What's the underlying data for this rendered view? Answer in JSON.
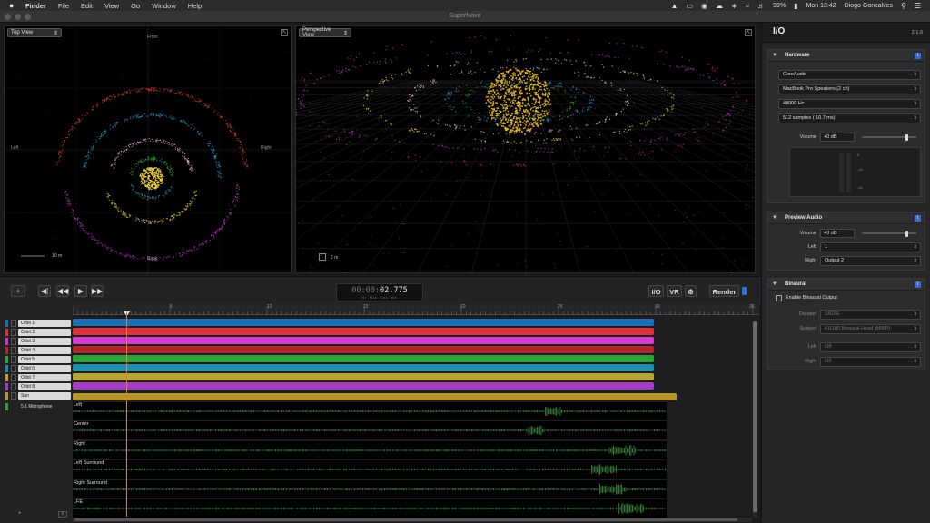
{
  "menubar": {
    "apple_icon": "apple-icon",
    "items": [
      {
        "label": "Finder",
        "bold": true
      },
      {
        "label": "File"
      },
      {
        "label": "Edit"
      },
      {
        "label": "View"
      },
      {
        "label": "Go"
      },
      {
        "label": "Window"
      },
      {
        "label": "Help"
      }
    ],
    "battery": "99%",
    "clock": "Mon 13:42",
    "user": "Diogo Goncalves"
  },
  "window": {
    "title": "SuperNova"
  },
  "top_view": {
    "mode": "Top View",
    "front": "Front",
    "back": "Back",
    "left": "Left",
    "right": "Right",
    "scale": "10 m"
  },
  "perspective_view": {
    "mode": "Perspective View",
    "scale": "2 m"
  },
  "transport": {
    "add": "+",
    "timecode_prefix": "00:00:",
    "timecode_value": "02.775",
    "timecode_units": "Hr  Min  Sec  Ms",
    "io": "I/O",
    "vr": "VR",
    "render": "Render"
  },
  "ruler": {
    "ticks": [
      "5",
      "10",
      "15",
      "20",
      "25",
      "30",
      "35"
    ]
  },
  "tracks": [
    {
      "name": "Orbit 1",
      "color": "#1f6fb4"
    },
    {
      "name": "Orbit 2",
      "color": "#e0323c"
    },
    {
      "name": "Orbit 3",
      "color": "#d43bd0"
    },
    {
      "name": "Orbit 4",
      "color": "#b3242b"
    },
    {
      "name": "Orbit 5",
      "color": "#2ea33a"
    },
    {
      "name": "Orbit 6",
      "color": "#1e8fa8"
    },
    {
      "name": "Orbit 7",
      "color": "#b8a536"
    },
    {
      "name": "Orbit 8",
      "color": "#a43dc4"
    },
    {
      "name": "Sun",
      "color": "#b8952a"
    },
    {
      "name": "5.1 Microphone",
      "color": "#2ea33a"
    }
  ],
  "audio_channels": [
    "Left",
    "Center",
    "Right",
    "Left Surround",
    "Right Surround",
    "LFE"
  ],
  "panel": {
    "title": "I/O",
    "version": "2.1.0",
    "hardware": {
      "title": "Hardware",
      "driver": "CoreAudio",
      "device": "MacBook Pro Speakers (2 ch)",
      "rate": "48000 Hz",
      "buffer": "512 samples ( 10.7 ms)",
      "volume_label": "Volume",
      "volume": "+0 dB",
      "volume_level": 0.82,
      "meter_ticks": [
        "0",
        "-10",
        "-40"
      ]
    },
    "preview": {
      "title": "Preview Audio",
      "volume_label": "Volume",
      "volume": "+0 dB",
      "volume_level": 0.82,
      "left_label": "Left",
      "left": "1",
      "right_label": "Right",
      "right": "Output 2"
    },
    "binaural": {
      "title": "Binaural",
      "enable": "Enable Binaural Output",
      "dataset_label": "Dataset",
      "dataset": "SADIE",
      "subject_label": "Subject",
      "subject": "KU100 Binaural Head (MINP)",
      "left_label": "Left",
      "left": "Off",
      "right_label": "Right",
      "right": "Off"
    }
  }
}
